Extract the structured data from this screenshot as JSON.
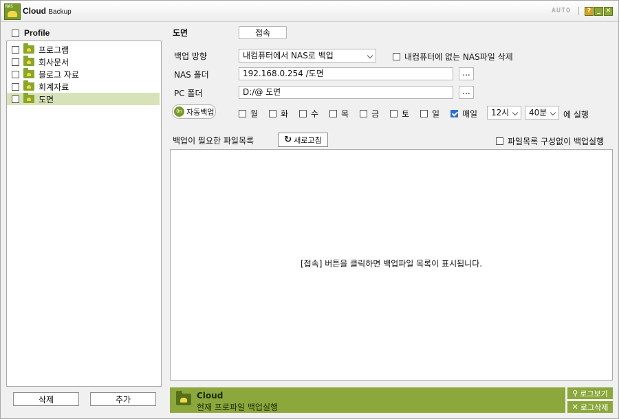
{
  "titlebar": {
    "app_name": "Cloud",
    "app_name_suffix": "Backup",
    "logo_text": "NAS",
    "auto_label": "AUTO",
    "help_symbol": "?",
    "close_symbol": "✕"
  },
  "sidebar": {
    "header_label": "Profile",
    "items": [
      {
        "label": "프로그램"
      },
      {
        "label": "회사문서"
      },
      {
        "label": "블로그 자료"
      },
      {
        "label": "회계자료"
      },
      {
        "label": "도면"
      }
    ],
    "selected_index": 4,
    "delete_label": "삭제",
    "add_label": "추가"
  },
  "profile": {
    "name": "도면",
    "connect_label": "접속"
  },
  "form": {
    "direction_label": "백업 방향",
    "direction_value": "내컴퓨터에서 NAS로 백업",
    "delete_missing_label": "내컴퓨터에 없는 NAS파일 삭제",
    "nas_folder_label": "NAS 폴더",
    "nas_folder_value": "192.168.0.254 /도면",
    "pc_folder_label": "PC 폴더",
    "pc_folder_value": "D:/@ 도면",
    "browse_label": "...",
    "auto_backup_label": "자동백업",
    "auto_backup_state": "On",
    "days": [
      {
        "label": "월",
        "checked": false
      },
      {
        "label": "화",
        "checked": false
      },
      {
        "label": "수",
        "checked": false
      },
      {
        "label": "목",
        "checked": false
      },
      {
        "label": "금",
        "checked": false
      },
      {
        "label": "토",
        "checked": false
      },
      {
        "label": "일",
        "checked": false
      },
      {
        "label": "매일",
        "checked": true
      }
    ],
    "hour_value": "12시",
    "minute_value": "40분",
    "run_suffix": "에 실행"
  },
  "file_list": {
    "title": "백업이 필요한 파일목록",
    "refresh_label": "새로고침",
    "skip_list_label": "파일목록 구성없이 백업실행",
    "empty_message": "[접속] 버튼을 클릭하면 백업파일 목록이 표시됩니다."
  },
  "status": {
    "title": "Cloud",
    "text": "현재 프로파일 백업실행",
    "log_view_label": "로그보기",
    "log_delete_label": "로그삭제"
  },
  "colors": {
    "accent": "#8ca83c",
    "selected_row": "#d8e2b8",
    "checkbox_checked": "#2e6fce"
  }
}
